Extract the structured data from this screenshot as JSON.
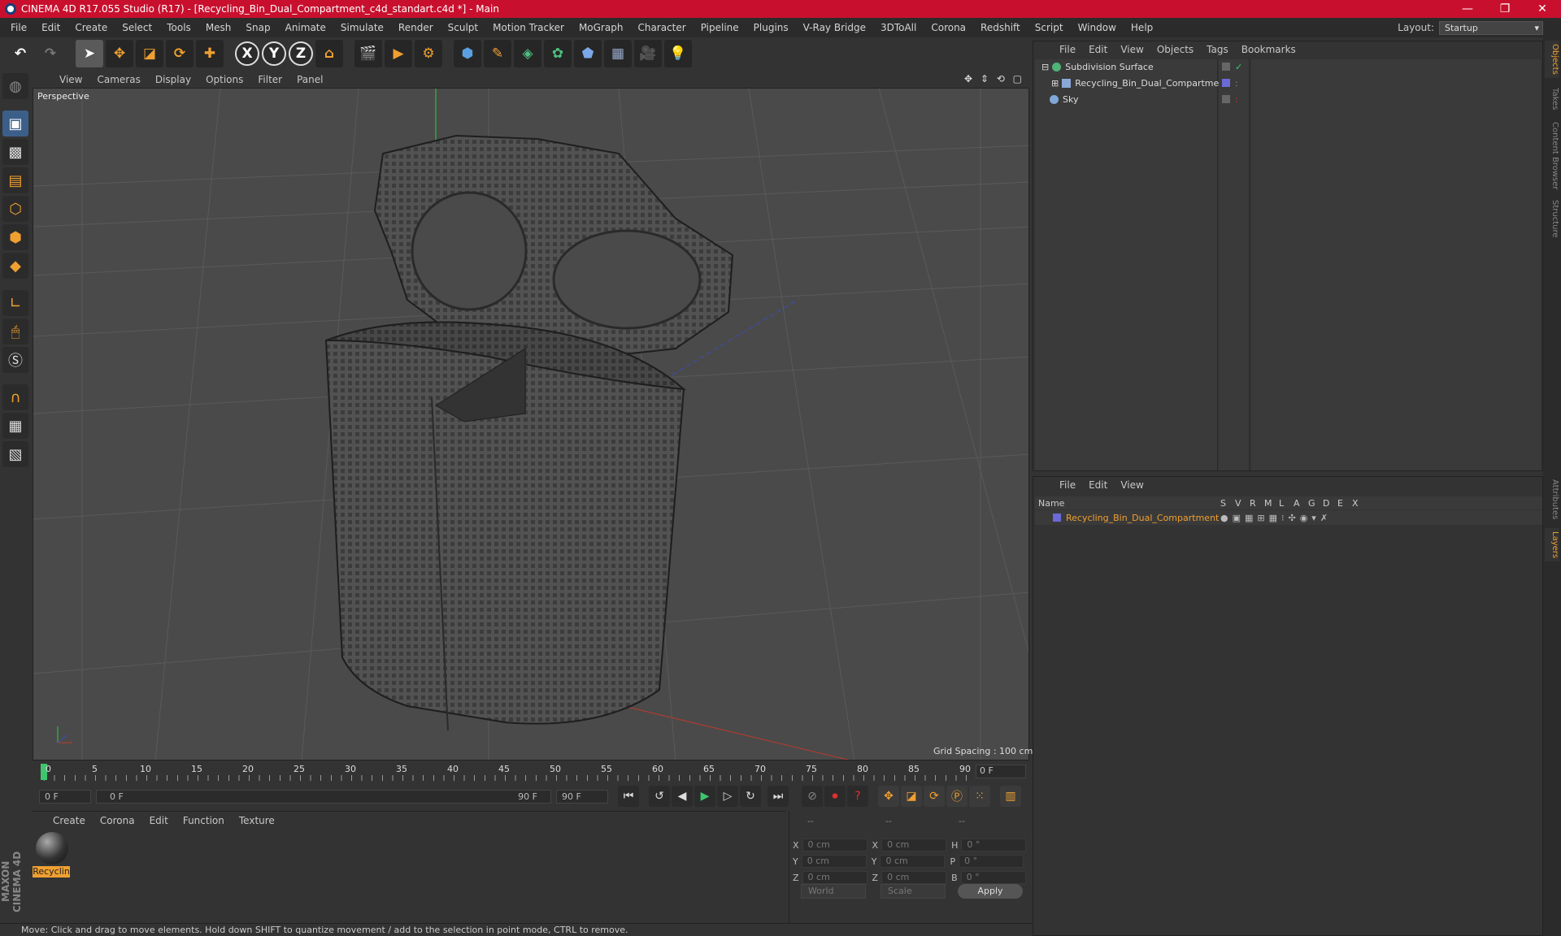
{
  "window": {
    "title": "CINEMA 4D R17.055 Studio (R17) - [Recycling_Bin_Dual_Compartment_c4d_standart.c4d *] - Main",
    "buttons": [
      "—",
      "❐",
      "✕"
    ]
  },
  "menubar": {
    "items": [
      "File",
      "Edit",
      "Create",
      "Select",
      "Tools",
      "Mesh",
      "Snap",
      "Animate",
      "Simulate",
      "Render",
      "Sculpt",
      "Motion Tracker",
      "MoGraph",
      "Character",
      "Pipeline",
      "Plugins",
      "V-Ray Bridge",
      "3DToAll",
      "Corona",
      "Redshift",
      "Script",
      "Window",
      "Help"
    ],
    "layout_label": "Layout:",
    "layout_value": "Startup"
  },
  "toolbar": {
    "axis_x": "X",
    "axis_y": "Y",
    "axis_z": "Z"
  },
  "viewport": {
    "menu": [
      "View",
      "Cameras",
      "Display",
      "Options",
      "Filter",
      "Panel"
    ],
    "nav_icons": "✥ ⇕ ⟲ ▢",
    "label": "Perspective",
    "grid_spacing": "Grid Spacing : 100 cm"
  },
  "timeline": {
    "ticks": [
      "0",
      "5",
      "10",
      "15",
      "20",
      "25",
      "30",
      "35",
      "40",
      "45",
      "50",
      "55",
      "60",
      "65",
      "70",
      "75",
      "80",
      "85",
      "90"
    ],
    "current_frame": "0 F",
    "start_field": "0 F",
    "range_start": "0 F",
    "range_end": "90 F",
    "end_field": "90 F"
  },
  "material_manager": {
    "menu": [
      "Create",
      "Corona",
      "Edit",
      "Function",
      "Texture"
    ],
    "materials": [
      {
        "name": "Recyclin"
      }
    ]
  },
  "coordinates": {
    "headers": [
      "--",
      "--",
      "--"
    ],
    "rows": [
      {
        "a": "X",
        "av": "0 cm",
        "b": "X",
        "bv": "0 cm",
        "c": "H",
        "cv": "0 °"
      },
      {
        "a": "Y",
        "av": "0 cm",
        "b": "Y",
        "bv": "0 cm",
        "c": "P",
        "cv": "0 °"
      },
      {
        "a": "Z",
        "av": "0 cm",
        "b": "Z",
        "bv": "0 cm",
        "c": "B",
        "cv": "0 °"
      }
    ],
    "mode": "World",
    "transform": "Scale",
    "apply": "Apply"
  },
  "status": "Move: Click and drag to move elements. Hold down SHIFT to quantize movement / add to the selection in point mode, CTRL to remove.",
  "object_manager": {
    "menu": [
      "File",
      "Edit",
      "View",
      "Objects",
      "Tags",
      "Bookmarks"
    ],
    "objects": [
      {
        "name": "Subdivision Surface",
        "icon_color": "#4fb37a"
      },
      {
        "name": "Recycling_Bin_Dual_Compartment",
        "icon_color": "#8aa9d8"
      },
      {
        "name": "Sky",
        "icon_color": "#7fa8d8"
      }
    ]
  },
  "layer_manager": {
    "menu": [
      "File",
      "Edit",
      "View"
    ],
    "columns": [
      "Name",
      "S",
      "V",
      "R",
      "M",
      "L",
      "A",
      "G",
      "D",
      "E",
      "X"
    ],
    "layers": [
      {
        "name": "Recycling_Bin_Dual_Compartment",
        "color": "#6a6ad8"
      }
    ]
  },
  "right_tabs": [
    "Objects",
    "Takes",
    "Content Browser",
    "Structure",
    "Attributes",
    "Layers"
  ],
  "maxon_label": "MAXON CINEMA 4D"
}
